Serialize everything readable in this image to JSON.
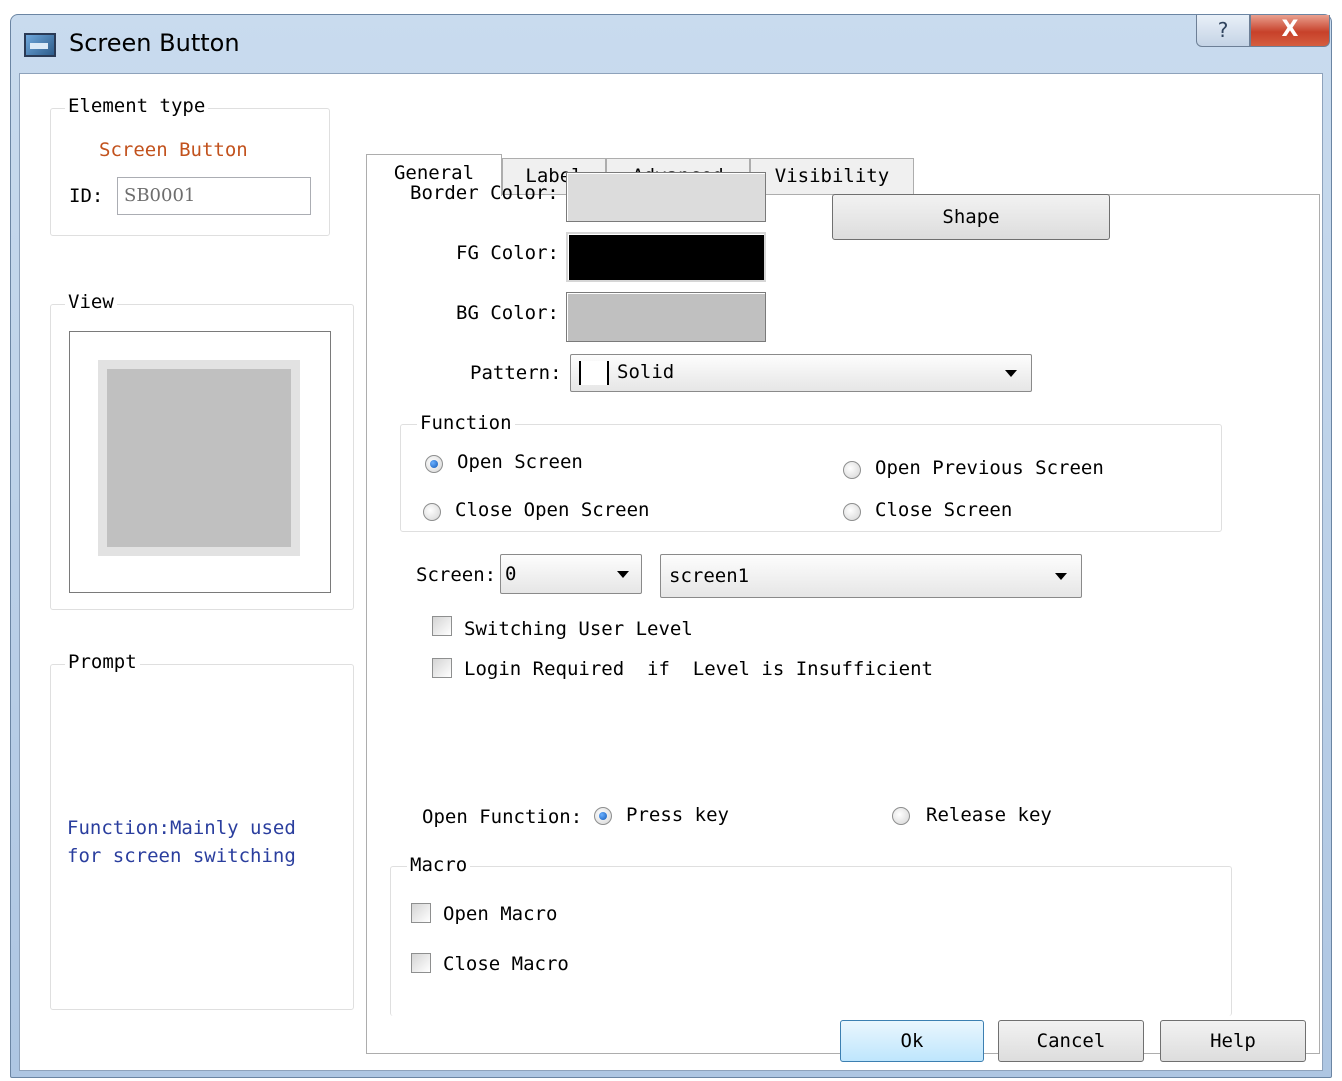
{
  "window": {
    "title": "Screen Button",
    "help_glyph": "?",
    "close_glyph": "X"
  },
  "element_type": {
    "legend": "Element type",
    "value": "Screen Button",
    "id_label": "ID:",
    "id_value": "SB0001",
    "value_color": "#c2521d"
  },
  "view": {
    "legend": "View",
    "preview_color": "#c0c0c0"
  },
  "prompt": {
    "legend": "Prompt",
    "text_line1": "Function:Mainly used",
    "text_line2": "for screen switching",
    "text_color": "#2a3e9e"
  },
  "tabs": [
    {
      "label": "General",
      "active": true
    },
    {
      "label": "Label",
      "active": false
    },
    {
      "label": "Advanced",
      "active": false
    },
    {
      "label": "Visibility",
      "active": false
    }
  ],
  "general": {
    "border_color_label": "Border Color:",
    "border_color": "#dcdcdc",
    "fg_color_label": "FG Color:",
    "fg_color": "#000000",
    "bg_color_label": "BG Color:",
    "bg_color": "#c0c0c0",
    "shape_button": "Shape",
    "pattern_label": "Pattern:",
    "pattern_value": "Solid",
    "function": {
      "legend": "Function",
      "options": [
        {
          "label": "Open Screen",
          "selected": true
        },
        {
          "label": "Open Previous Screen",
          "selected": false
        },
        {
          "label": "Close Open Screen",
          "selected": false
        },
        {
          "label": "Close Screen",
          "selected": false
        }
      ]
    },
    "screen_label": "Screen:",
    "screen_number": "0",
    "screen_name": "screen1",
    "switching_user_level": {
      "label": "Switching User Level",
      "checked": false
    },
    "login_required": {
      "label": "Login Required  if  Level is Insufficient",
      "checked": false
    },
    "open_function_label": "Open Function:",
    "open_function_options": [
      {
        "label": "Press key",
        "selected": true
      },
      {
        "label": "Release key",
        "selected": false
      }
    ],
    "macro": {
      "legend": "Macro",
      "open_macro": {
        "label": "Open Macro",
        "checked": false
      },
      "close_macro": {
        "label": "Close Macro",
        "checked": false
      }
    }
  },
  "footer": {
    "ok": "Ok",
    "cancel": "Cancel",
    "help": "Help"
  }
}
